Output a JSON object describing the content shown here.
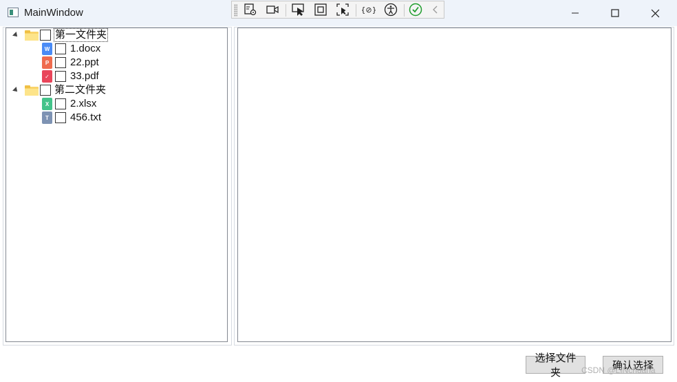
{
  "window": {
    "title": "MainWindow"
  },
  "tree": {
    "folders": [
      {
        "name": "第一文件夹",
        "files": [
          {
            "name": "1.docx",
            "badge": "W",
            "color": "#4a8bf5"
          },
          {
            "name": "22.ppt",
            "badge": "P",
            "color": "#ef6b4e"
          },
          {
            "name": "33.pdf",
            "badge": "✓",
            "color": "#e9455a"
          }
        ]
      },
      {
        "name": "第二文件夹",
        "files": [
          {
            "name": "2.xlsx",
            "badge": "X",
            "color": "#43c38a"
          },
          {
            "name": "456.txt",
            "badge": "T",
            "color": "#7e93b3"
          }
        ]
      }
    ]
  },
  "buttons": {
    "select_folder": "选择文件夹",
    "confirm": "确认选择"
  },
  "watermark": "CSDN @LINchuana"
}
